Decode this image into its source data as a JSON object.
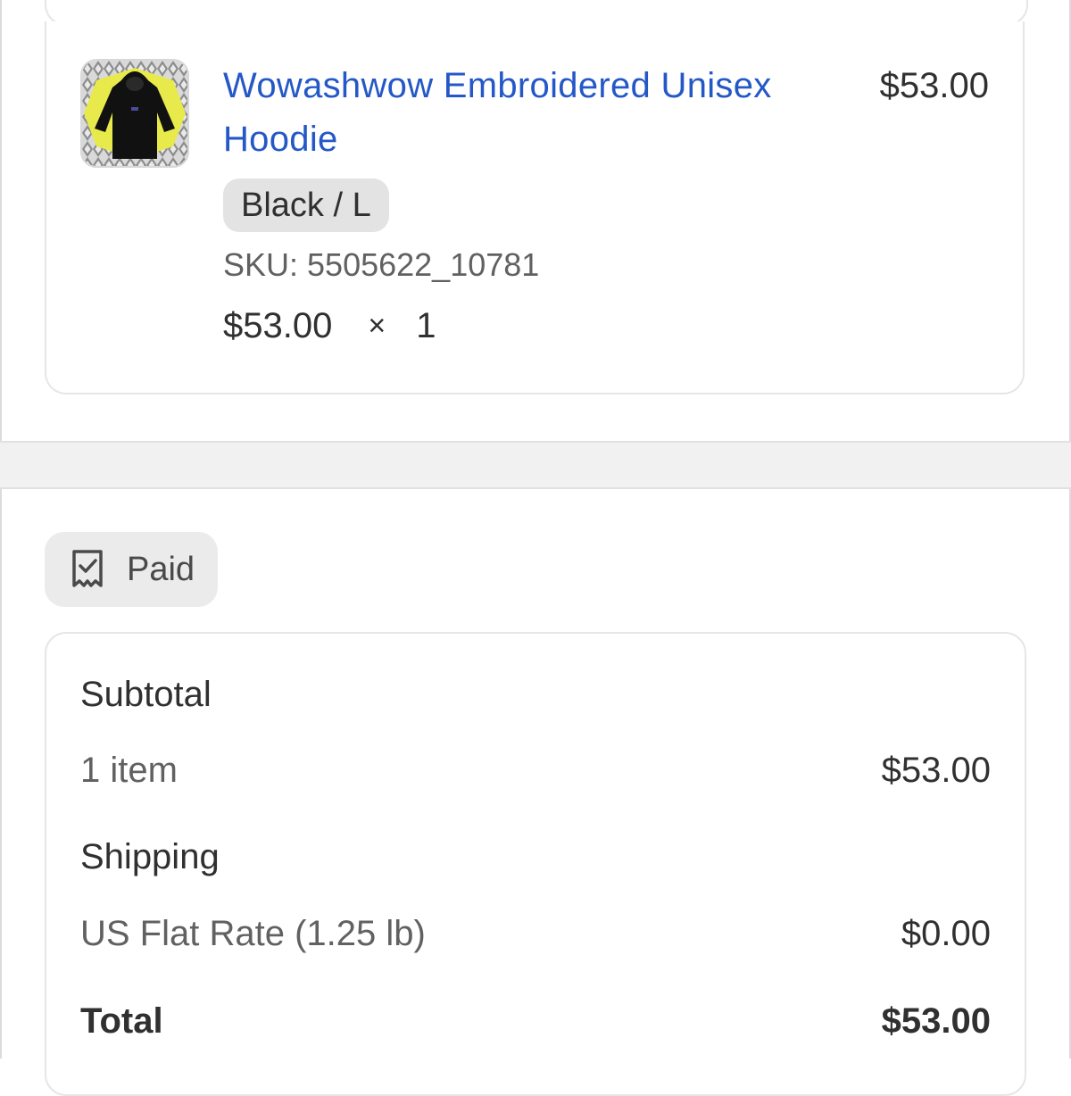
{
  "order_item": {
    "title": "Wowashwow Embroidered Unisex Hoodie",
    "price": "$53.00",
    "variant": "Black / L",
    "sku": "SKU: 5505622_10781",
    "unit_price": "$53.00",
    "times": "×",
    "quantity": "1",
    "thumbnail_icon": "hoodie-product-image"
  },
  "payment_status": {
    "label": "Paid",
    "icon": "receipt-check-icon"
  },
  "summary": {
    "subtotal_label": "Subtotal",
    "items_label": "1 item",
    "items_amount": "$53.00",
    "shipping_label": "Shipping",
    "shipping_method": "US Flat Rate (1.25 lb)",
    "shipping_amount": "$0.00",
    "total_label": "Total",
    "total_amount": "$53.00"
  },
  "colors": {
    "link_blue": "#2458c7",
    "text_primary": "#303030",
    "text_secondary": "#616161",
    "badge_bg": "#e3e3e3"
  }
}
